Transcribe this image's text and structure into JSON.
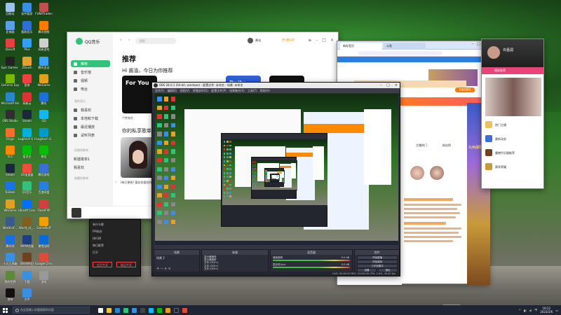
{
  "desktop": {
    "icons": [
      {
        "label": "回收站",
        "color": "#9cc4e8",
        "col": 0,
        "row": 0
      },
      {
        "label": "软件管家",
        "color": "#3a8ee6",
        "col": 1,
        "row": 0
      },
      {
        "label": "FUNXTraden",
        "color": "#c05050",
        "col": 2,
        "row": 0
      },
      {
        "label": "此电脑",
        "color": "#5aa0e6",
        "col": 0,
        "row": 1
      },
      {
        "label": "酷狗音乐",
        "color": "#2e6fd6",
        "col": 1,
        "row": 1
      },
      {
        "label": "腾讯视频",
        "color": "#ff7a00",
        "col": 2,
        "row": 1
      },
      {
        "label": "Ubisoft",
        "color": "#e84040",
        "col": 0,
        "row": 2
      },
      {
        "label": "Plus",
        "color": "#30a0ff",
        "col": 1,
        "row": 2
      },
      {
        "label": "网易游戏",
        "color": "#d0d0d0",
        "col": 2,
        "row": 2
      },
      {
        "label": "Epic Games Launcher",
        "color": "#222",
        "col": 0,
        "row": 3
      },
      {
        "label": "ZBrush",
        "color": "#e6a030",
        "col": 1,
        "row": 3
      },
      {
        "label": "腾讯会议",
        "color": "#3aa0ff",
        "col": 2,
        "row": 3
      },
      {
        "label": "GeForce Experience",
        "color": "#76b900",
        "col": 0,
        "row": 4
      },
      {
        "label": "宽带",
        "color": "#f04040",
        "col": 1,
        "row": 4
      },
      {
        "label": "WeGame",
        "color": "#e0a020",
        "col": 2,
        "row": 4
      },
      {
        "label": "Microsoft Edge",
        "color": "#2b86c9",
        "col": 0,
        "row": 5
      },
      {
        "label": "网易云",
        "color": "#d33",
        "col": 1,
        "row": 5
      },
      {
        "label": "腾讯",
        "color": "#1e6fd6",
        "col": 2,
        "row": 5
      },
      {
        "label": "OBS Studio",
        "color": "#302e31",
        "col": 0,
        "row": 6
      },
      {
        "label": "Steam",
        "color": "#1b2838",
        "col": 1,
        "row": 6
      },
      {
        "label": "QQ",
        "color": "#12b7f5",
        "col": 2,
        "row": 6
      },
      {
        "label": "Origin",
        "color": "#f56c2d",
        "col": 0,
        "row": 7
      },
      {
        "label": "Logitech G Hub",
        "color": "#00b0e0",
        "col": 1,
        "row": 7
      },
      {
        "label": "Logitech G",
        "color": "#0099cc",
        "col": 2,
        "row": 7
      },
      {
        "label": "VLC",
        "color": "#ff8800",
        "col": 0,
        "row": 8
      },
      {
        "label": "爱奇艺",
        "color": "#00be06",
        "col": 1,
        "row": 8
      },
      {
        "label": "微信",
        "color": "#09bb07",
        "col": 2,
        "row": 8
      },
      {
        "label": "Steam",
        "color": "#1b2838",
        "col": 0,
        "row": 9
      },
      {
        "label": "UU加速器",
        "color": "#f24c3d",
        "col": 1,
        "row": 9
      },
      {
        "label": "腾讯游戏",
        "color": "#3a6fd6",
        "col": 2,
        "row": 9
      },
      {
        "label": "ToDesk",
        "color": "#1a73e8",
        "col": 0,
        "row": 10
      },
      {
        "label": "QQ音乐",
        "color": "#31c27c",
        "col": 1,
        "row": 10
      },
      {
        "label": "百度网盘",
        "color": "#2a7de1",
        "col": 2,
        "row": 10
      },
      {
        "label": "WeGame",
        "color": "#e0a020",
        "col": 0,
        "row": 11
      },
      {
        "label": "Ubisoft Connect",
        "color": "#0070ff",
        "col": 1,
        "row": 11
      },
      {
        "label": "FlashFXP",
        "color": "#d04040",
        "col": 2,
        "row": 11
      },
      {
        "label": "World of ...",
        "color": "#3a5a8a",
        "col": 0,
        "row": 12
      },
      {
        "label": "World_of_...",
        "color": "#806020",
        "col": 1,
        "row": 12
      },
      {
        "label": "GameBuff",
        "color": "#f0a000",
        "col": 2,
        "row": 12
      },
      {
        "label": "腾讯网",
        "color": "#1a6fe0",
        "col": 0,
        "row": 13
      },
      {
        "label": "WOW台服",
        "color": "#1a4080",
        "col": 1,
        "row": 13
      },
      {
        "label": "暴雪战网",
        "color": "#0a6ad8",
        "col": 2,
        "row": 13
      },
      {
        "label": "小丸工具箱",
        "color": "#3a90e0",
        "col": 0,
        "row": 14
      },
      {
        "label": "WOW怀旧",
        "color": "#704020",
        "col": 1,
        "row": 14
      },
      {
        "label": "Google Chrome",
        "color": "#dd4b39",
        "col": 2,
        "row": 14
      },
      {
        "label": "我的世界",
        "color": "#5a8a3a",
        "col": 0,
        "row": 15
      },
      {
        "label": "下载",
        "color": "#3a90e0",
        "col": 1,
        "row": 15
      },
      {
        "label": "游戏",
        "color": "#999",
        "col": 2,
        "row": 15
      },
      {
        "label": "剪映",
        "color": "#111",
        "col": 0,
        "row": 16
      },
      {
        "label": "文件",
        "color": "#3a90e0",
        "col": 1,
        "row": 16
      }
    ]
  },
  "qqmusic": {
    "logo": "QQ音乐",
    "search_placeholder": "搜索",
    "user": "酱油",
    "vip": "开通VIP",
    "nav": [
      "推荐",
      "音乐馆",
      "视频",
      "电台"
    ],
    "section_mine": "我的音乐",
    "mine": [
      "我喜欢",
      "本地和下载",
      "最近播放",
      "试听列表"
    ],
    "section_created": "创建的歌单",
    "created": [
      "新建歌单1",
      "我喜欢"
    ],
    "section_collected": "收藏的歌单",
    "page_title": "推荐",
    "greeting": "Hi 酱油，今日为你推荐",
    "card1_label": "For You",
    "card1_caption": "个性电台",
    "card2_label": "Daily",
    "sub_title": "你的私享歌单",
    "cover_caption": "[每日更新] 喜欢你喜欢的..."
  },
  "qqsub": {
    "rows": [
      "有什么歌",
      "FM电台",
      "排行榜",
      "每日推荐",
      "打开"
    ],
    "btn1": "会员专享",
    "btn2": "精品专享"
  },
  "browser": {
    "tab1": "新标签页",
    "tab2": "斗鱼",
    "orange_btn": "充值送豪礼",
    "game_text": "九州战场",
    "chat_header": "主播热门",
    "chat_sub": "粉丝榜",
    "bottom_txt": "发送"
  },
  "chat": {
    "name": "许嘉润",
    "banner": "精彩推荐",
    "rows": [
      "热门主播",
      "最新动态",
      "魔兽怀旧服推荐",
      "赛季荣耀"
    ]
  },
  "obs": {
    "title": "OBS 28.0.1 (64-bit, windows) - 配置文件: 未命名 - 场景: 未命名",
    "menu": "文件(F) 编辑(E) 视图(V) 停靠部件(D) 配置文件(P) 场景集合(S) 工具(T) 帮助(H)",
    "docks": {
      "scenes": "场景",
      "sources": "来源",
      "mixer": "混音器",
      "transitions": "转场",
      "controls": "控件"
    },
    "scene_item": "场景 2",
    "sources": [
      "显示器捕获",
      "显示器捕获",
      "文本 (GDI+)",
      "文本 (GDI+)",
      "文本 (GDI+)"
    ],
    "mixer": [
      "桌面音频",
      "麦克风/Aux"
    ],
    "mixer_db": [
      "0.0 dB",
      "0.0 dB"
    ],
    "controls": [
      "开始直播",
      "开始录制",
      "工作室模式",
      "设置",
      "退出"
    ],
    "status": "LIVE: 00:00:00   REC: 00:00:00   CPU: 1.6%, 30.00 fps"
  },
  "taskbar": {
    "search_placeholder": "在这里输入你要搜索的内容",
    "time": "19:22",
    "date": "2023/2/6",
    "lang": "中"
  },
  "colors": {
    "qq_green": "#31c27c",
    "obs_bg": "#2b2e38",
    "taskbar": "#1f2533",
    "browser_blue": "#2a7de1",
    "browser_orange": "#ff7a00"
  }
}
